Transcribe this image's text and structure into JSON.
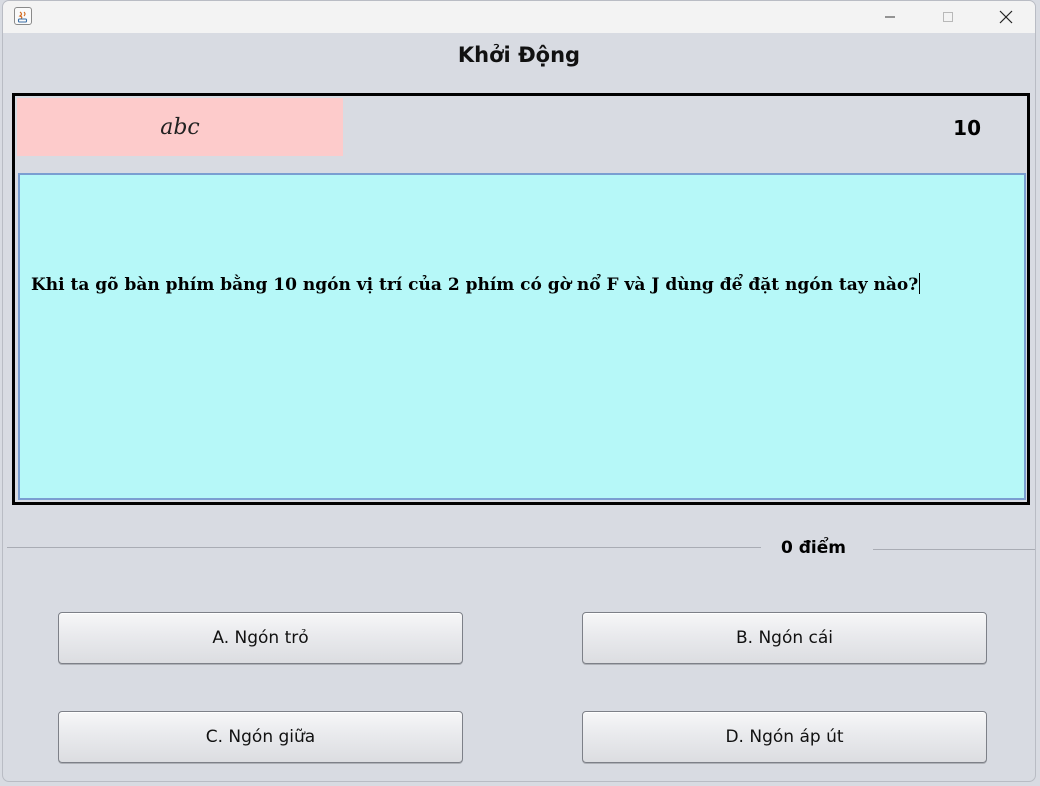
{
  "window": {
    "controls": {
      "minimize_glyph": "─",
      "maximize_glyph": "☐",
      "close_glyph": "✕"
    },
    "app_icon": "java-icon"
  },
  "game": {
    "title": "Khởi Động",
    "answer_text": "abc",
    "timer": "10",
    "question": "Khi ta gõ bàn phím bằng 10 ngón vị trí của 2 phím có gờ nổ F và J dùng để đặt ngón tay nào?",
    "score": "0 điểm"
  },
  "options": [
    {
      "label": "A. Ngón trỏ"
    },
    {
      "label": "B. Ngón cái"
    },
    {
      "label": "C. Ngón giữa"
    },
    {
      "label": "D. Ngón áp út"
    }
  ],
  "colors": {
    "answer_bg": "#fdcbcb",
    "question_bg": "#b6f8f8",
    "question_border": "#7a9ed1",
    "panel_border": "#000000",
    "window_bg": "#d8dbe2"
  }
}
